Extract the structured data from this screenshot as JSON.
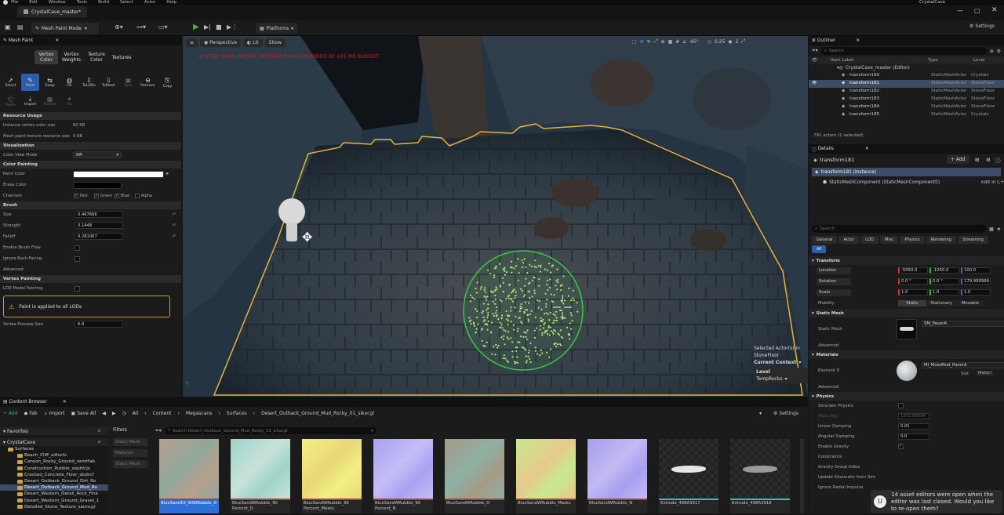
{
  "menu": [
    "File",
    "Edit",
    "Window",
    "Tools",
    "Build",
    "Select",
    "Actor",
    "Help"
  ],
  "project_name": "CrystalCave",
  "level_tab": "CrystalCave_master*",
  "mode": "Mesh Paint Mode",
  "platforms": "Platforms",
  "settings": "Settings",
  "mesh_paint": {
    "tab_title": "Mesh Paint",
    "mode_tabs": [
      "Vertex Color",
      "Vertex Weights",
      "Texture Color",
      "Textures"
    ],
    "tools": [
      "Select",
      "Paint",
      "Swap",
      "Fill",
      "ToLODs",
      "ToMesh",
      "Save",
      "Remove",
      "Copy"
    ],
    "tools2": [
      "Paste",
      "Import",
      "Texture",
      "Fix"
    ],
    "resource_usage": "Resource Usage",
    "instance_label": "Instance vertex color size",
    "instance_value": "60 KB",
    "mesh_label": "Mesh paint texture resource size",
    "mesh_value": "0 KB",
    "visualization": "Visualization",
    "color_view_label": "Color View Mode",
    "color_view_value": "Off",
    "color_painting": "Color Painting",
    "paint_color": "Paint Color",
    "erase_color": "Erase Color",
    "channels": "Channels",
    "channel_names": [
      "Red",
      "Green",
      "Blue",
      "Alpha"
    ],
    "brush": "Brush",
    "size_label": "Size",
    "size_value": "0.467666",
    "strength_label": "Strength",
    "strength_value": "0.1448",
    "falloff_label": "Falloff",
    "falloff_value": "0.281067",
    "enable_flow": "Enable Brush Flow",
    "ignore_back": "Ignore Back-Facing",
    "advanced": "Advanced",
    "vertex_painting": "Vertex Painting",
    "lod_painting": "LOD Model Painting",
    "warning": "Paint is applied to all LODs",
    "preview_label": "Vertex Preview Size",
    "preview_value": "6.0"
  },
  "viewport": {
    "perspective": "Perspective",
    "lit": "Lit",
    "show": "Show",
    "warning_text": "SYSTEM OVERLOADED: TEXTURE POOL EXCEEDED BY 435 MB BUDGET",
    "snap_angle": "45°",
    "snap_scale": "0.25",
    "cam": "2",
    "selected_text": "Selected Actor(s) in",
    "selected_sub": "StoneFloor",
    "current_context": "Current Context",
    "level": "Level",
    "level_value": "TempRocks"
  },
  "outliner": {
    "title": "Outliner",
    "search": "Search",
    "cols": [
      "Item Label",
      "Type",
      "Level"
    ],
    "root": "CrystalCave_master (Editor)",
    "rows": [
      {
        "label": "transform180",
        "type": "StaticMeshActor",
        "level": "Crystals"
      },
      {
        "label": "transform181",
        "type": "StaticMeshActor",
        "level": "StoneFloor"
      },
      {
        "label": "transform182",
        "type": "StaticMeshActor",
        "level": "StoneFloor"
      },
      {
        "label": "transform183",
        "type": "StaticMeshActor",
        "level": "StoneFloor"
      },
      {
        "label": "transform184",
        "type": "StaticMeshActor",
        "level": "StoneFloor"
      },
      {
        "label": "transform185",
        "type": "StaticMeshActor",
        "level": "Crystals"
      }
    ],
    "count": "791 actors (1 selected)"
  },
  "details": {
    "title": "Details",
    "name": "transform181",
    "add": "+ Add",
    "instance": "transform181 (Instance)",
    "component": "StaticMeshComponent (StaticMeshComponent0)",
    "edit": "Edit in C++",
    "search": "Search",
    "tabs": [
      "General",
      "Actor",
      "LOD",
      "Misc",
      "Physics",
      "Rendering",
      "Streaming",
      "All"
    ],
    "transform": "Transform",
    "location": "Location",
    "loc": [
      "-5050.0",
      "-1050.0",
      "100.0"
    ],
    "rotation": "Rotation",
    "rot": [
      "0.0 °",
      "0.0 °",
      "179.999999 °"
    ],
    "scale": "Scale",
    "scl": [
      "1.0",
      "1.0",
      "1.0"
    ],
    "mobility": "Mobility",
    "mob": [
      "Static",
      "Stationary",
      "Movable"
    ],
    "static_mesh": "Static Mesh",
    "static_mesh_label": "Static Mesh",
    "mesh_value": "SM_PaverA",
    "advanced": "Advanced",
    "materials": "Materials",
    "element0": "Element 0",
    "material_value": "MI_MossMud_PaverA",
    "slot": "Slot",
    "material_name": "Materi",
    "physics": "Physics",
    "simulate": "Simulate Physics",
    "mass": "Mass (kg)",
    "mass_value": "1253.60084",
    "linear": "Linear Damping",
    "linear_value": "0.01",
    "angular": "Angular Damping",
    "angular_value": "0.0",
    "gravity": "Enable Gravity",
    "constraints": "Constraints",
    "gravity_group": "Gravity Group Index",
    "kinematic": "Update Kinematic from Sim",
    "radial": "Ignore Radial Impulse"
  },
  "toast": {
    "text": "14 asset editors were open when the editor was last closed. Would you like to re-open them?"
  },
  "content_browser": {
    "title": "Content Browser",
    "add": "+ Add",
    "fab": "Fab",
    "import": "Import",
    "save_all": "Save All",
    "path": [
      "All",
      "Content",
      "Megascans",
      "Surfaces",
      "Desert_Outback_Ground_Mud_Rocky_01_sikxcgl"
    ],
    "settings": "Settings",
    "favorites": "Favorites",
    "root": "CrystalCave",
    "surfaces": "Surfaces",
    "folders": [
      "Beach_Cliff_xdhicfv",
      "Canyon_Rocky_Ground_vemtfab",
      "Construction_Rubble_xephfcjs",
      "Cracked_Concrete_Floor_sbokcf",
      "Desert_Outback_Ground_Dirt_Ro",
      "Desert_Outback_Ground_Mud_Ro",
      "Desert_Western_Detail_Rock_Fine",
      "Desert_Western_Ground_Gravel_1",
      "Detailed_Stone_Texture_sauncgt"
    ],
    "filters": "Filters",
    "filter_items": [
      "Static Mesh",
      "Material",
      "Static Mesh"
    ],
    "search": "Search Desert_Outback_Ground_Mud_Rocky_01_sikxcgl",
    "assets": [
      {
        "name": "BlueSand10_W90Rubble_D",
        "c1": "#b9a08f",
        "c2": "#8fa79a"
      },
      {
        "name": "BlueSandWRubble_90 Percent_D",
        "c1": "#9fd3c9",
        "c2": "#c7e3da"
      },
      {
        "name": "BlueSandWRubble_90 Percent_Masks",
        "c1": "#f2ef86",
        "c2": "#e9d875"
      },
      {
        "name": "BlueSandWRubble_90 Percent_N",
        "c1": "#a9a2f2",
        "c2": "#c4bdf7"
      },
      {
        "name": "BlueSandWRubble_D",
        "c1": "#a59a86",
        "c2": "#8fb1a4"
      },
      {
        "name": "BlueSandWRubble_Masks",
        "c1": "#c6e98e",
        "c2": "#e7c98b"
      },
      {
        "name": "BlueSandWRubble_N",
        "c1": "#a6a0ee",
        "c2": "#c2b9f4"
      },
      {
        "name": "Extrude_498A3917",
        "c1": "#222",
        "c2": "#333"
      },
      {
        "name": "Extrude_498A3918",
        "c1": "#222",
        "c2": "#333"
      }
    ]
  }
}
